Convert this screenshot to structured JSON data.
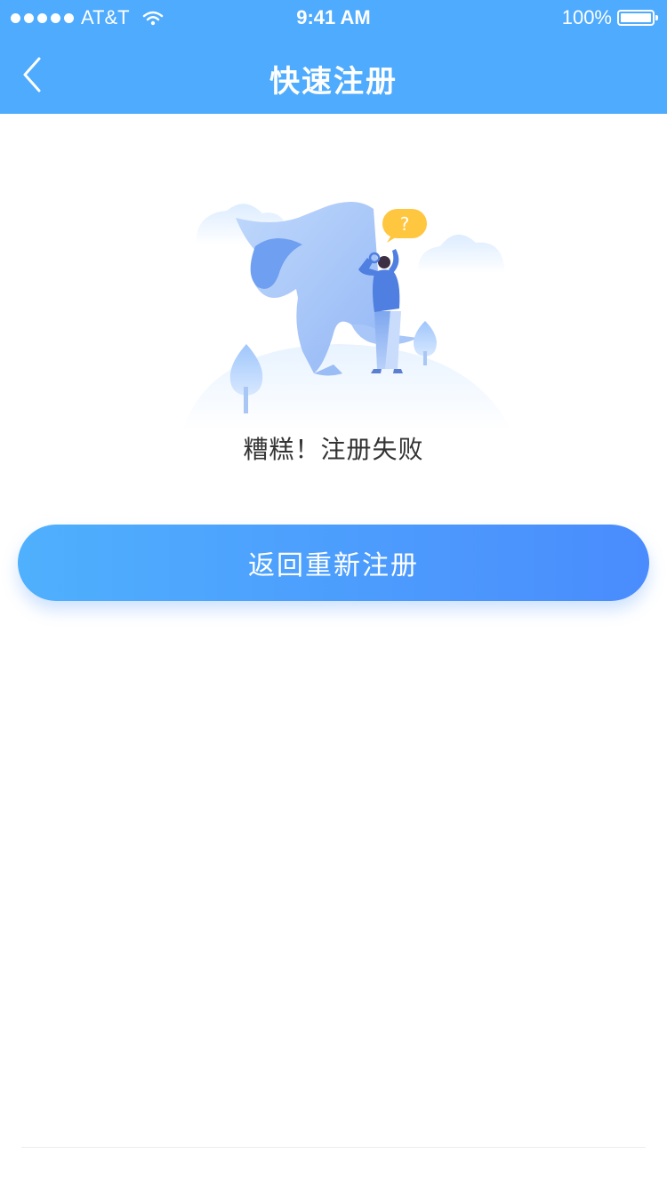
{
  "status_bar": {
    "carrier": "AT&T",
    "time": "9:41 AM",
    "battery": "100%"
  },
  "nav": {
    "title": "快速注册",
    "back_icon": "chevron-left-icon"
  },
  "illustration": {
    "badge_text": "?",
    "name": "registration-failed-illustration"
  },
  "result": {
    "message": "糟糕！注册失败"
  },
  "actions": {
    "retry_label": "返回重新注册"
  },
  "colors": {
    "header_bg": "#4eabfd",
    "button_gradient_start": "#4fb0fd",
    "button_gradient_end": "#4a8cfd",
    "badge": "#ffc640"
  }
}
